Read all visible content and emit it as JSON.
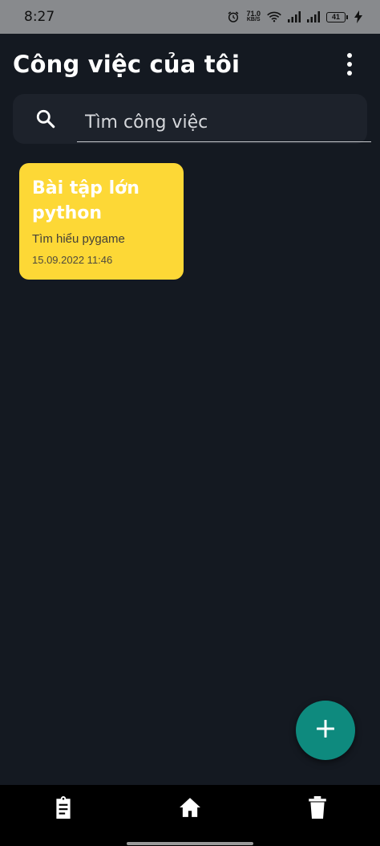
{
  "status_bar": {
    "time": "8:27",
    "net_speed_value": "71.0",
    "net_speed_unit": "KB/S",
    "battery_level": "41",
    "icons": [
      "alarm-icon",
      "wifi-icon",
      "signal-icon",
      "signal-icon",
      "battery-icon",
      "charging-icon"
    ]
  },
  "header": {
    "title": "Công việc của tôi",
    "menu_icon": "more-vertical-icon"
  },
  "search": {
    "placeholder": "Tìm công việc",
    "value": "",
    "icon": "search-icon"
  },
  "tasks": [
    {
      "title": "Bài tập lớn python",
      "description": "Tìm hiểu pygame",
      "date": "15.09.2022 11:46",
      "color": "#fdd836"
    }
  ],
  "fab": {
    "icon": "plus-icon",
    "color": "#0e8a7e"
  },
  "bottom_nav": {
    "items": [
      "clipboard-icon",
      "home-icon",
      "trash-icon"
    ]
  },
  "colors": {
    "background": "#141921",
    "search_background": "#1d222b",
    "status_bar": "#888a8d"
  }
}
